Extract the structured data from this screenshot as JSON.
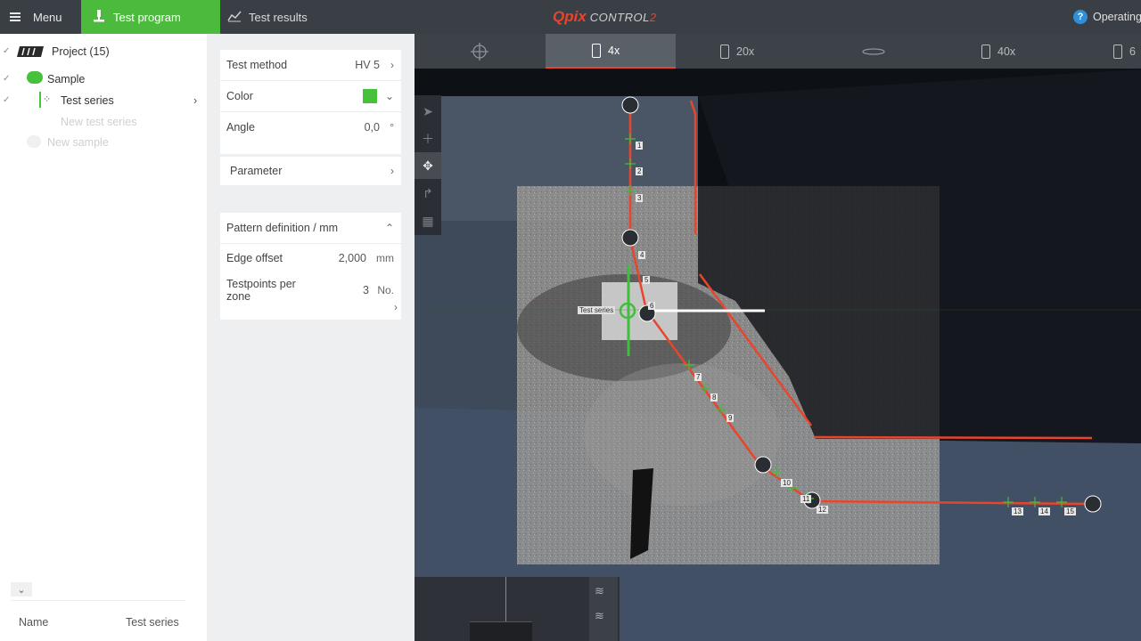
{
  "header": {
    "menu_label": "Menu",
    "tab_program": "Test program",
    "tab_results": "Test results",
    "logo_q": "Q",
    "logo_pix": "pix",
    "logo_control": "CONTROL",
    "logo_two": "2",
    "help_label": "?",
    "operating_label": "Operating"
  },
  "tree": {
    "project": "Project (15)",
    "sample": "Sample",
    "test_series": "Test series",
    "new_test_series": "New test series",
    "new_sample": "New sample",
    "footer_name": "Name",
    "footer_value": "Test series"
  },
  "settings": {
    "test_method_label": "Test method",
    "test_method_value": "HV 5",
    "color_label": "Color",
    "angle_label": "Angle",
    "angle_value": "0,0",
    "angle_unit": "°",
    "parameter_label": "Parameter",
    "pattern_label": "Pattern definition / mm",
    "edge_offset_label": "Edge offset",
    "edge_offset_value": "2,000",
    "edge_offset_unit": "mm",
    "testpoints_label_1": "Testpoints per",
    "testpoints_label_2": "zone",
    "testpoints_value": "3",
    "testpoints_unit": "No."
  },
  "colors": {
    "accent_green": "#4cba3c",
    "path_red": "#e8452c",
    "swatch_green": "#45c13b"
  },
  "objectives": {
    "obj_4x": "4x",
    "obj_20x": "20x",
    "obj_40x": "40x",
    "obj_partial": "6"
  },
  "overlay": {
    "series_label": "Test series",
    "points": [
      "1",
      "2",
      "3",
      "4",
      "5",
      "6",
      "7",
      "8",
      "9",
      "10",
      "11",
      "12",
      "13",
      "14",
      "15"
    ]
  }
}
